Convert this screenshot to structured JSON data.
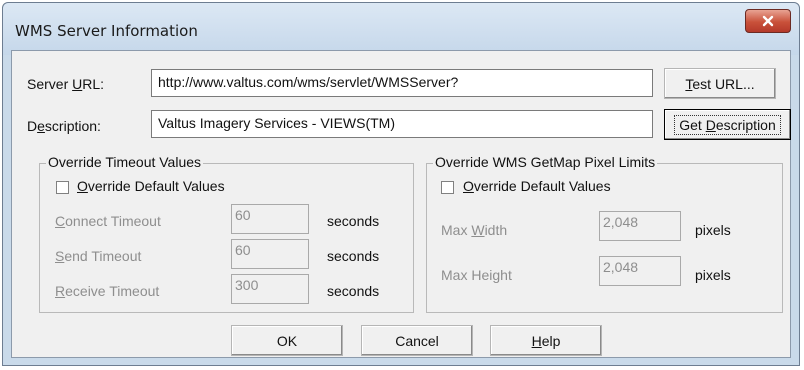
{
  "window": {
    "title": "WMS Server Information"
  },
  "server_url": {
    "label_pre": "Server ",
    "label_key": "U",
    "label_post": "RL:",
    "value": "http://www.valtus.com/wms/servlet/WMSServer?"
  },
  "description": {
    "label_pre": "D",
    "label_key": "e",
    "label_post": "scription:",
    "value": "Valtus Imagery Services - VIEWS(TM)"
  },
  "buttons": {
    "test_url": {
      "key": "T",
      "rest": "est URL..."
    },
    "get_description": {
      "pre": "Get ",
      "key": "D",
      "rest": "escription"
    },
    "ok": "OK",
    "cancel": "Cancel",
    "help": {
      "key": "H",
      "rest": "elp"
    }
  },
  "timeout_group": {
    "title": "Override Timeout Values",
    "override": {
      "key": "O",
      "rest": "verride Default Values",
      "checked": false
    },
    "rows": [
      {
        "key": "C",
        "rest": "onnect Timeout",
        "value": "60",
        "unit": "seconds"
      },
      {
        "key": "S",
        "rest": "end Timeout",
        "value": "60",
        "unit": "seconds"
      },
      {
        "key": "R",
        "rest": "eceive Timeout",
        "value": "300",
        "unit": "seconds"
      }
    ]
  },
  "pixel_group": {
    "title": "Override WMS GetMap Pixel Limits",
    "override": {
      "key": "O",
      "rest": "verride Default Values",
      "checked": false
    },
    "rows": [
      {
        "pre": "Max ",
        "key": "W",
        "rest": "idth",
        "value": "2,048",
        "unit": "pixels"
      },
      {
        "pre": "Max Hei",
        "key": "g",
        "rest": "ht",
        "value": "2,048",
        "unit": "pixels"
      }
    ]
  },
  "icons": {
    "close": "close-icon"
  },
  "colors": {
    "close_button": "#c9513a",
    "title_bar": "#c5d7ea",
    "dialog_bg": "#f0f0f0"
  }
}
